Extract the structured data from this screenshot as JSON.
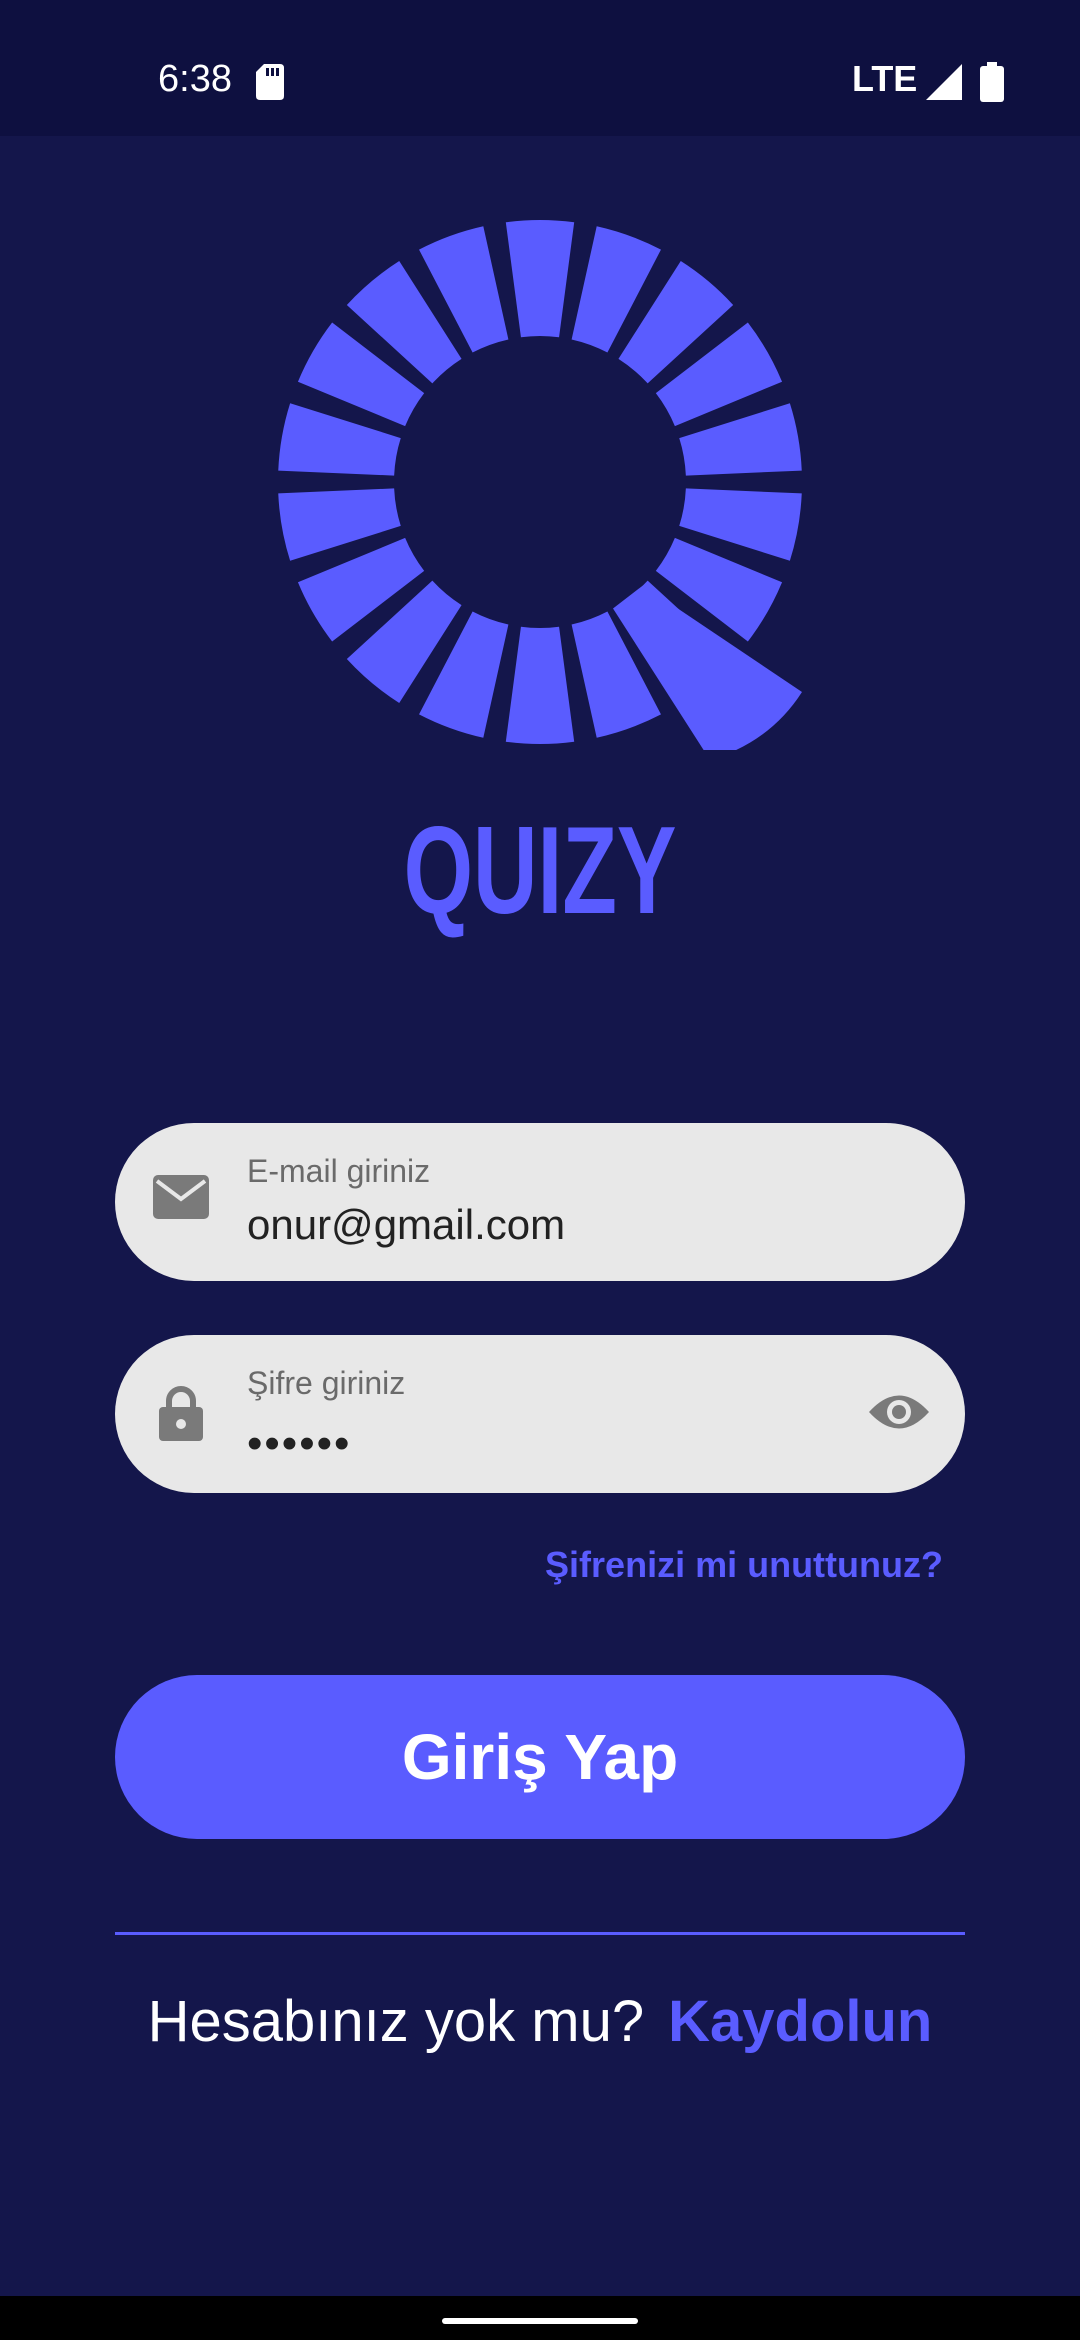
{
  "status_bar": {
    "time": "6:38",
    "network": "LTE"
  },
  "logo": {
    "icon": "quizy-ring-logo",
    "title": "QUIZY",
    "color": "#5a5cff"
  },
  "email_field": {
    "label": "E-mail giriniz",
    "value": "onur@gmail.com",
    "icon": "mail-icon"
  },
  "password_field": {
    "label": "Şifre giriniz",
    "value": "••••••",
    "icon": "lock-icon",
    "toggle_icon": "eye-icon"
  },
  "forgot_password": "Şifrenizi mi unuttunuz?",
  "login_button": "Giriş Yap",
  "signup": {
    "prompt": "Hesabınız yok mu?",
    "link": "Kaydolun"
  },
  "colors": {
    "background": "#14164b",
    "accent": "#5a5cff",
    "field_background": "#e8e8e8"
  }
}
